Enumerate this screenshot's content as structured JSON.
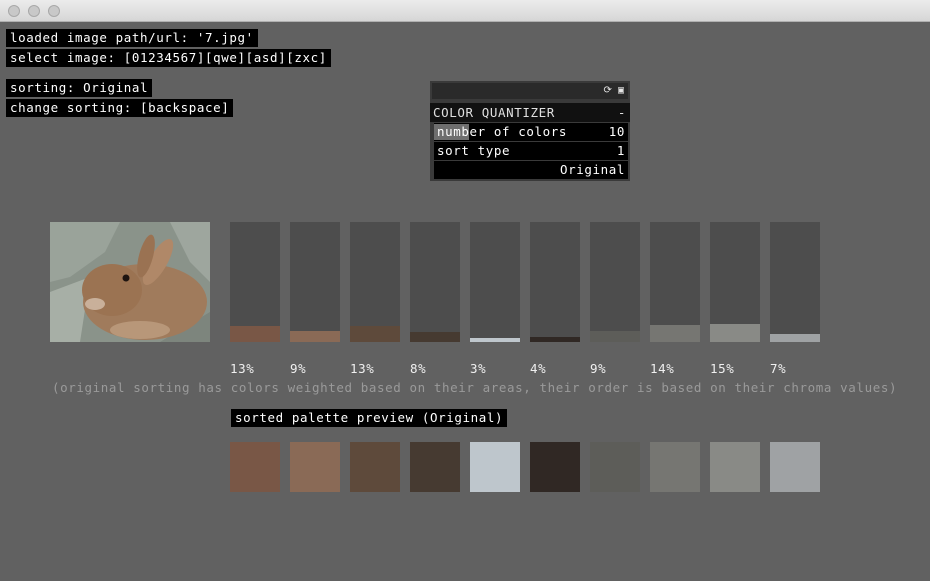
{
  "window": {
    "buttons": [
      "close",
      "minimize",
      "zoom"
    ]
  },
  "info": {
    "loaded_image": "loaded image path/url: '7.jpg'",
    "select_image": "select image: [01234567][qwe][asd][zxc]",
    "sorting": "sorting: Original",
    "change_sorting": "change sorting: [backspace]"
  },
  "panel": {
    "title": "COLOR QUANTIZER",
    "collapse": "-",
    "number_of_colors": {
      "label": "number of colors",
      "value": "10",
      "fill_fraction": 0.18
    },
    "sort_type": {
      "label": "sort type",
      "value": "1"
    },
    "sort_name": "Original"
  },
  "image": {
    "name": "rabbit-photo"
  },
  "bars": [
    {
      "pct": "13%",
      "fraction": 0.13,
      "color": "#795746"
    },
    {
      "pct": "9%",
      "fraction": 0.09,
      "color": "#8a6a56"
    },
    {
      "pct": "13%",
      "fraction": 0.13,
      "color": "#5e4a3b"
    },
    {
      "pct": "8%",
      "fraction": 0.08,
      "color": "#463a31"
    },
    {
      "pct": "3%",
      "fraction": 0.03,
      "color": "#bec6cc"
    },
    {
      "pct": "4%",
      "fraction": 0.04,
      "color": "#302824"
    },
    {
      "pct": "9%",
      "fraction": 0.09,
      "color": "#5d5d59"
    },
    {
      "pct": "14%",
      "fraction": 0.14,
      "color": "#767672"
    },
    {
      "pct": "15%",
      "fraction": 0.15,
      "color": "#898a86"
    },
    {
      "pct": "7%",
      "fraction": 0.07,
      "color": "#9fa2a4"
    }
  ],
  "note": "(original sorting has colors weighted based on their areas, their order is based on their chroma values)",
  "preview": {
    "label": "sorted palette preview (Original)",
    "swatches": [
      "#795746",
      "#8a6a56",
      "#5e4a3b",
      "#463a31",
      "#bec6cc",
      "#302824",
      "#5d5d59",
      "#767672",
      "#898a86",
      "#9fa2a4"
    ]
  }
}
